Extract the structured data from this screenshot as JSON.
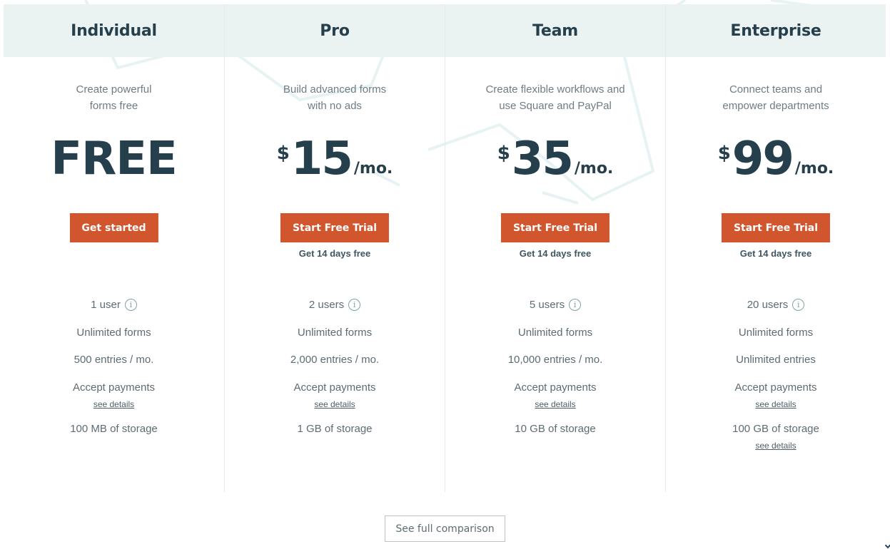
{
  "plans": [
    {
      "name": "Individual",
      "tagline_line1": "Create powerful",
      "tagline_line2": "forms free",
      "price_text": "FREE",
      "cta_label": "Get started",
      "users": "1 user",
      "forms": "Unlimited forms",
      "entries": "500 entries / mo.",
      "payments": "Accept payments",
      "payments_link": "see details",
      "storage": "100 MB of storage"
    },
    {
      "name": "Pro",
      "tagline_line1": "Build advanced forms",
      "tagline_line2": "with no ads",
      "currency": "$",
      "amount": "15",
      "period": "/mo.",
      "cta_label": "Start Free Trial",
      "trial_note": "Get 14 days free",
      "users": "2 users",
      "forms": "Unlimited forms",
      "entries": "2,000 entries / mo.",
      "payments": "Accept payments",
      "payments_link": "see details",
      "storage": "1 GB of storage"
    },
    {
      "name": "Team",
      "tagline_line1": "Create flexible workflows and",
      "tagline_line2": "use Square and PayPal",
      "currency": "$",
      "amount": "35",
      "period": "/mo.",
      "cta_label": "Start Free Trial",
      "trial_note": "Get 14 days free",
      "users": "5 users",
      "forms": "Unlimited forms",
      "entries": "10,000 entries / mo.",
      "payments": "Accept payments",
      "payments_link": "see details",
      "storage": "10 GB of storage"
    },
    {
      "name": "Enterprise",
      "tagline_line1": "Connect teams and",
      "tagline_line2": "empower departments",
      "currency": "$",
      "amount": "99",
      "period": "/mo.",
      "cta_label": "Start Free Trial",
      "trial_note": "Get 14 days free",
      "users": "20 users",
      "forms": "Unlimited forms",
      "entries": "Unlimited entries",
      "payments": "Accept payments",
      "payments_link": "see details",
      "storage": "100 GB of storage",
      "storage_link": "see details"
    }
  ],
  "info_icon_glyph": "i",
  "compare_button_label": "See full comparison",
  "colors": {
    "header_band": "#ebf2f2",
    "heading_text": "#263f4c",
    "cta_background": "#d2562d",
    "cta_text": "#ffffff",
    "body_text": "#5d6c73",
    "divider": "#e6ecec"
  }
}
